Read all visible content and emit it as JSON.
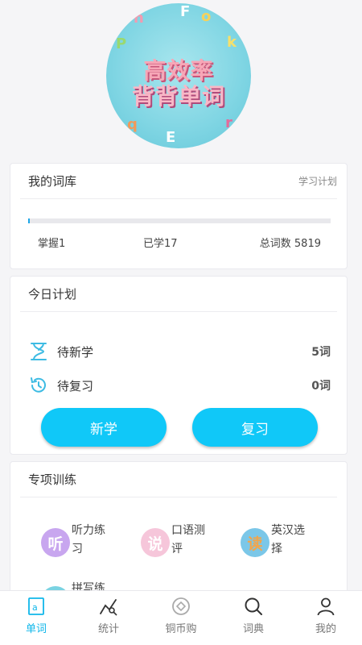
{
  "hero": {
    "line1": "高效率",
    "line2": "背背单词"
  },
  "library": {
    "title": "我的词库",
    "link": "学习计划",
    "progress": 0.0003,
    "mastered": "掌握1",
    "learned": "已学17",
    "total": "总词数 5819"
  },
  "plan": {
    "title": "今日计划",
    "new_label": "待新学",
    "new_count": "5词",
    "review_label": "待复习",
    "review_count": "0词",
    "btn_new": "新学",
    "btn_review": "复习"
  },
  "training": {
    "title": "专项训练",
    "items": [
      {
        "icon": "听",
        "label": "听力练习",
        "color": "#b890e6"
      },
      {
        "icon": "说",
        "label": "口语测评",
        "color": "#f4b7d2"
      },
      {
        "icon": "读",
        "label": "英汉选择",
        "color": "#f1a64e"
      },
      {
        "icon": "拼",
        "label": "拼写练",
        "color": "#6fcfe0"
      }
    ]
  },
  "tabs": [
    {
      "label": "单词",
      "icon": "word-icon"
    },
    {
      "label": "统计",
      "icon": "chart-icon"
    },
    {
      "label": "铜币购",
      "icon": "coin-icon"
    },
    {
      "label": "词典",
      "icon": "search-icon"
    },
    {
      "label": "我的",
      "icon": "user-icon"
    }
  ],
  "colors": {
    "accent": "#10c8f8",
    "progress": "#1ea7e8"
  }
}
